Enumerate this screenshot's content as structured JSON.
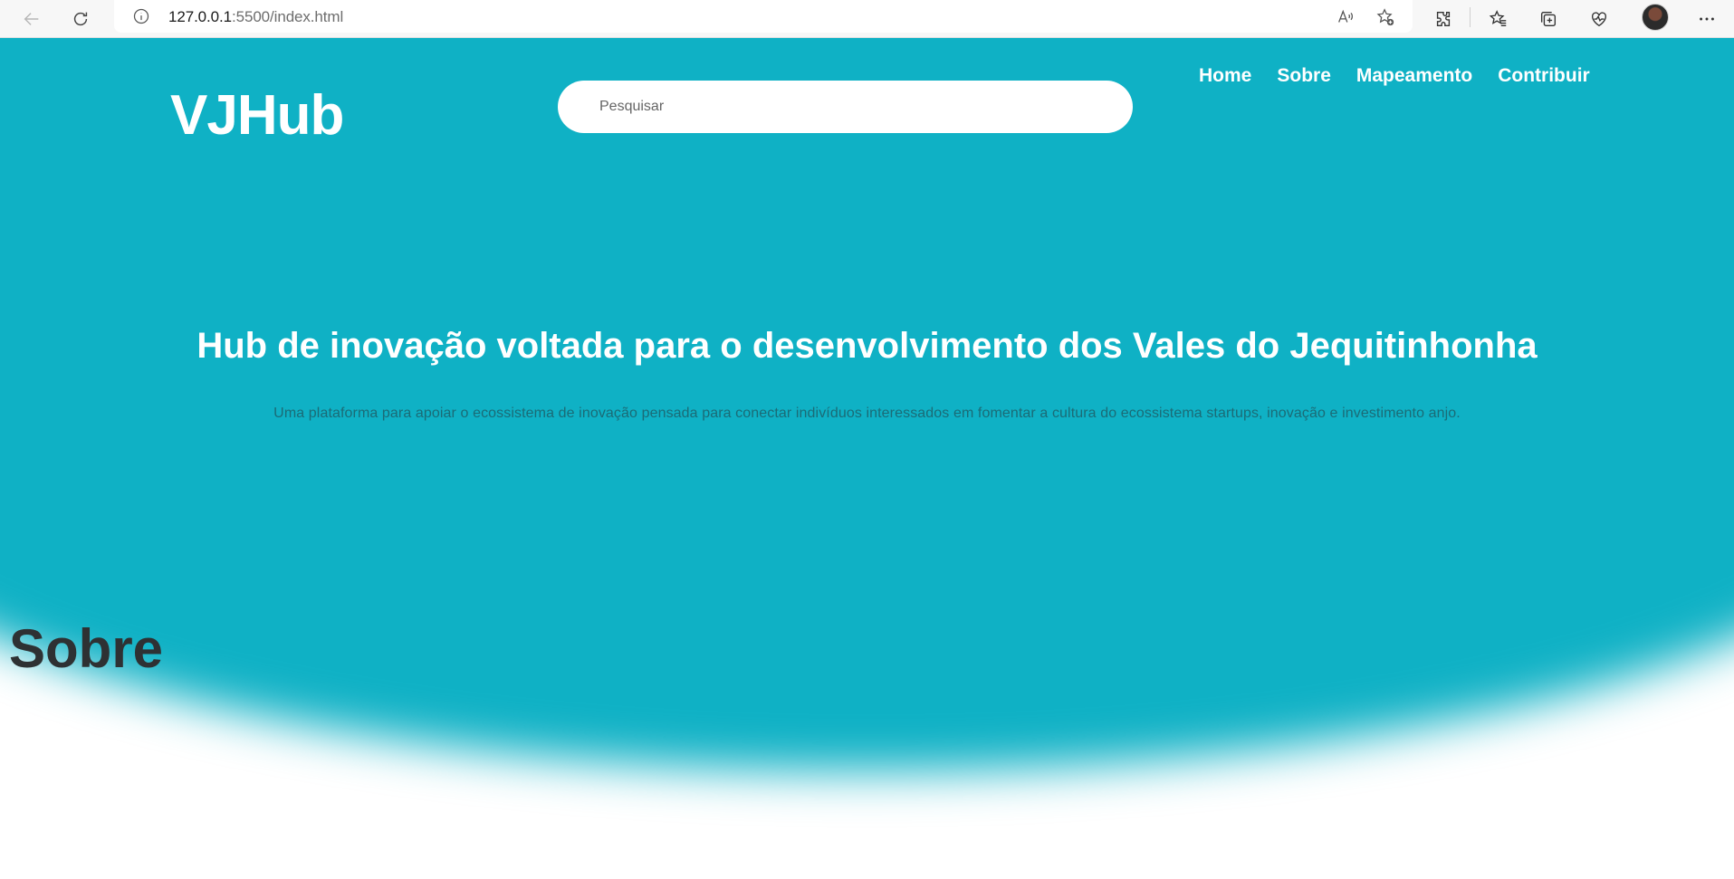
{
  "browser": {
    "url_host": "127.0.0.1",
    "url_rest": ":5500/index.html"
  },
  "site": {
    "logo": "VJHub",
    "search_placeholder": "Pesquisar",
    "nav": [
      "Home",
      "Sobre",
      "Mapeamento",
      "Contribuir"
    ]
  },
  "hero": {
    "title": "Hub de inovação voltada para o desenvolvimento dos Vales do Jequitinhonha",
    "subtitle": "Uma plataforma para apoiar o ecossistema de inovação pensada para conectar indivíduos interessados em fomentar a cultura do ecossistema startups, inovação e investimento anjo."
  },
  "section": {
    "title": "Sobre"
  },
  "colors": {
    "hero_bg": "#0fb1c5",
    "hero_text": "#ffffff",
    "section_title": "#2e3133"
  },
  "icons": [
    "back-arrow-icon",
    "reload-icon",
    "info-icon",
    "read-aloud-icon",
    "add-favorite-icon",
    "extensions-icon",
    "favorites-icon",
    "collections-icon",
    "health-icon",
    "more-icon"
  ]
}
